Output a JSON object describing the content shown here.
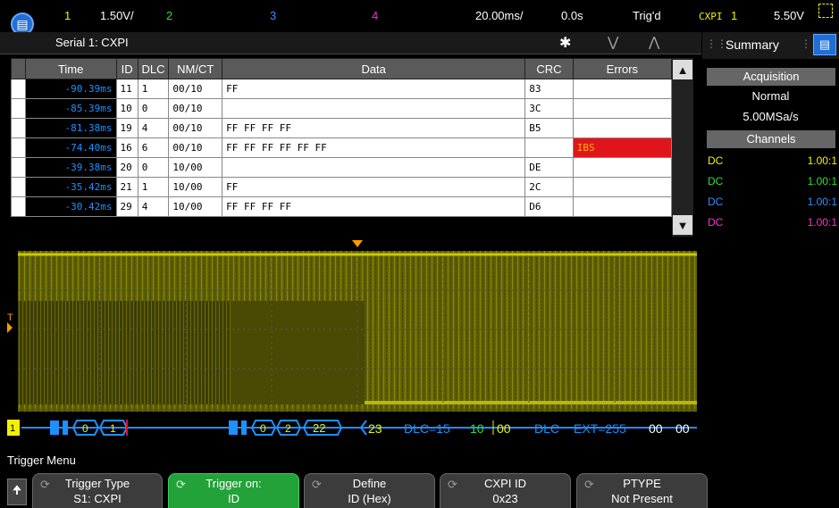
{
  "top_bar": {
    "ch1_num": "1",
    "ch1_scale": "1.50V/",
    "ch2_num": "2",
    "ch3_num": "3",
    "ch4_num": "4",
    "timebase": "20.00ms/",
    "delay": "0.0s",
    "trig_status": "Trig'd",
    "trig_proto": "CXPI",
    "trig_src": "1",
    "trig_level": "5.50V"
  },
  "serial_panel": {
    "title": "Serial 1: CXPI",
    "columns": [
      "Time",
      "ID",
      "DLC",
      "NM/CT",
      "Data",
      "CRC",
      "Errors"
    ],
    "rows": [
      {
        "time": "-90.39ms",
        "id": "11",
        "dlc": "1",
        "nmct": "00/10",
        "data": "FF",
        "crc": "83",
        "errors": ""
      },
      {
        "time": "-85.39ms",
        "id": "10",
        "dlc": "0",
        "nmct": "00/10",
        "data": "",
        "crc": "3C",
        "errors": ""
      },
      {
        "time": "-81.38ms",
        "id": "19",
        "dlc": "4",
        "nmct": "00/10",
        "data": "FF FF FF FF",
        "crc": "B5",
        "errors": ""
      },
      {
        "time": "-74.40ms",
        "id": "16",
        "dlc": "6",
        "nmct": "00/10",
        "data": "FF FF FF FF FF FF",
        "crc": "",
        "errors": "IBS"
      },
      {
        "time": "-39.38ms",
        "id": "20",
        "dlc": "0",
        "nmct": "10/00",
        "data": "",
        "crc": "DE",
        "errors": ""
      },
      {
        "time": "-35.42ms",
        "id": "21",
        "dlc": "1",
        "nmct": "10/00",
        "data": "FF",
        "crc": "2C",
        "errors": ""
      },
      {
        "time": "-30.42ms",
        "id": "29",
        "dlc": "4",
        "nmct": "10/00",
        "data": "FF FF FF FF",
        "crc": "D6",
        "errors": ""
      }
    ]
  },
  "right_panel": {
    "tab": "Summary",
    "acq_header": "Acquisition",
    "acq_mode": "Normal",
    "sample_rate": "5.00MSa/s",
    "channels_header": "Channels",
    "channels": [
      {
        "coupling": "DC",
        "ratio": "1.00:1",
        "color": "#f2f200"
      },
      {
        "coupling": "DC",
        "ratio": "1.00:1",
        "color": "#33dd33"
      },
      {
        "coupling": "DC",
        "ratio": "1.00:1",
        "color": "#3a8cff"
      },
      {
        "coupling": "DC",
        "ratio": "1.00:1",
        "color": "#ff2fd0"
      }
    ]
  },
  "waveform": {
    "trigger_marker": "T",
    "bus_label": "1",
    "bus_labels": {
      "a": "0",
      "b": "1",
      "c": "0",
      "d": "2",
      "e": "22",
      "f": "23",
      "dlc1": "DLC=15",
      "v1": "10",
      "v2": "00",
      "dlc2": "DLC",
      "ext": "EXT=255",
      "v3": "00",
      "v4": "00"
    }
  },
  "bottom_menu": {
    "title": "Trigger Menu",
    "softkeys": [
      {
        "line1": "Trigger Type",
        "line2": "S1: CXPI"
      },
      {
        "line1": "Trigger on:",
        "line2": "ID"
      },
      {
        "line1": "Define",
        "line2": "ID (Hex)"
      },
      {
        "line1": "CXPI ID",
        "line2": "0x23"
      },
      {
        "line1": "PTYPE",
        "line2": "Not Present"
      }
    ]
  },
  "colors": {
    "ch1": "#f2f200",
    "ch2": "#33dd33",
    "ch3": "#3a8cff",
    "ch4": "#ff2fd0",
    "error": "#e0151c",
    "time_text": "#1e90ff",
    "bus": "#1e90ff",
    "softkey_active": "#24a23a"
  }
}
